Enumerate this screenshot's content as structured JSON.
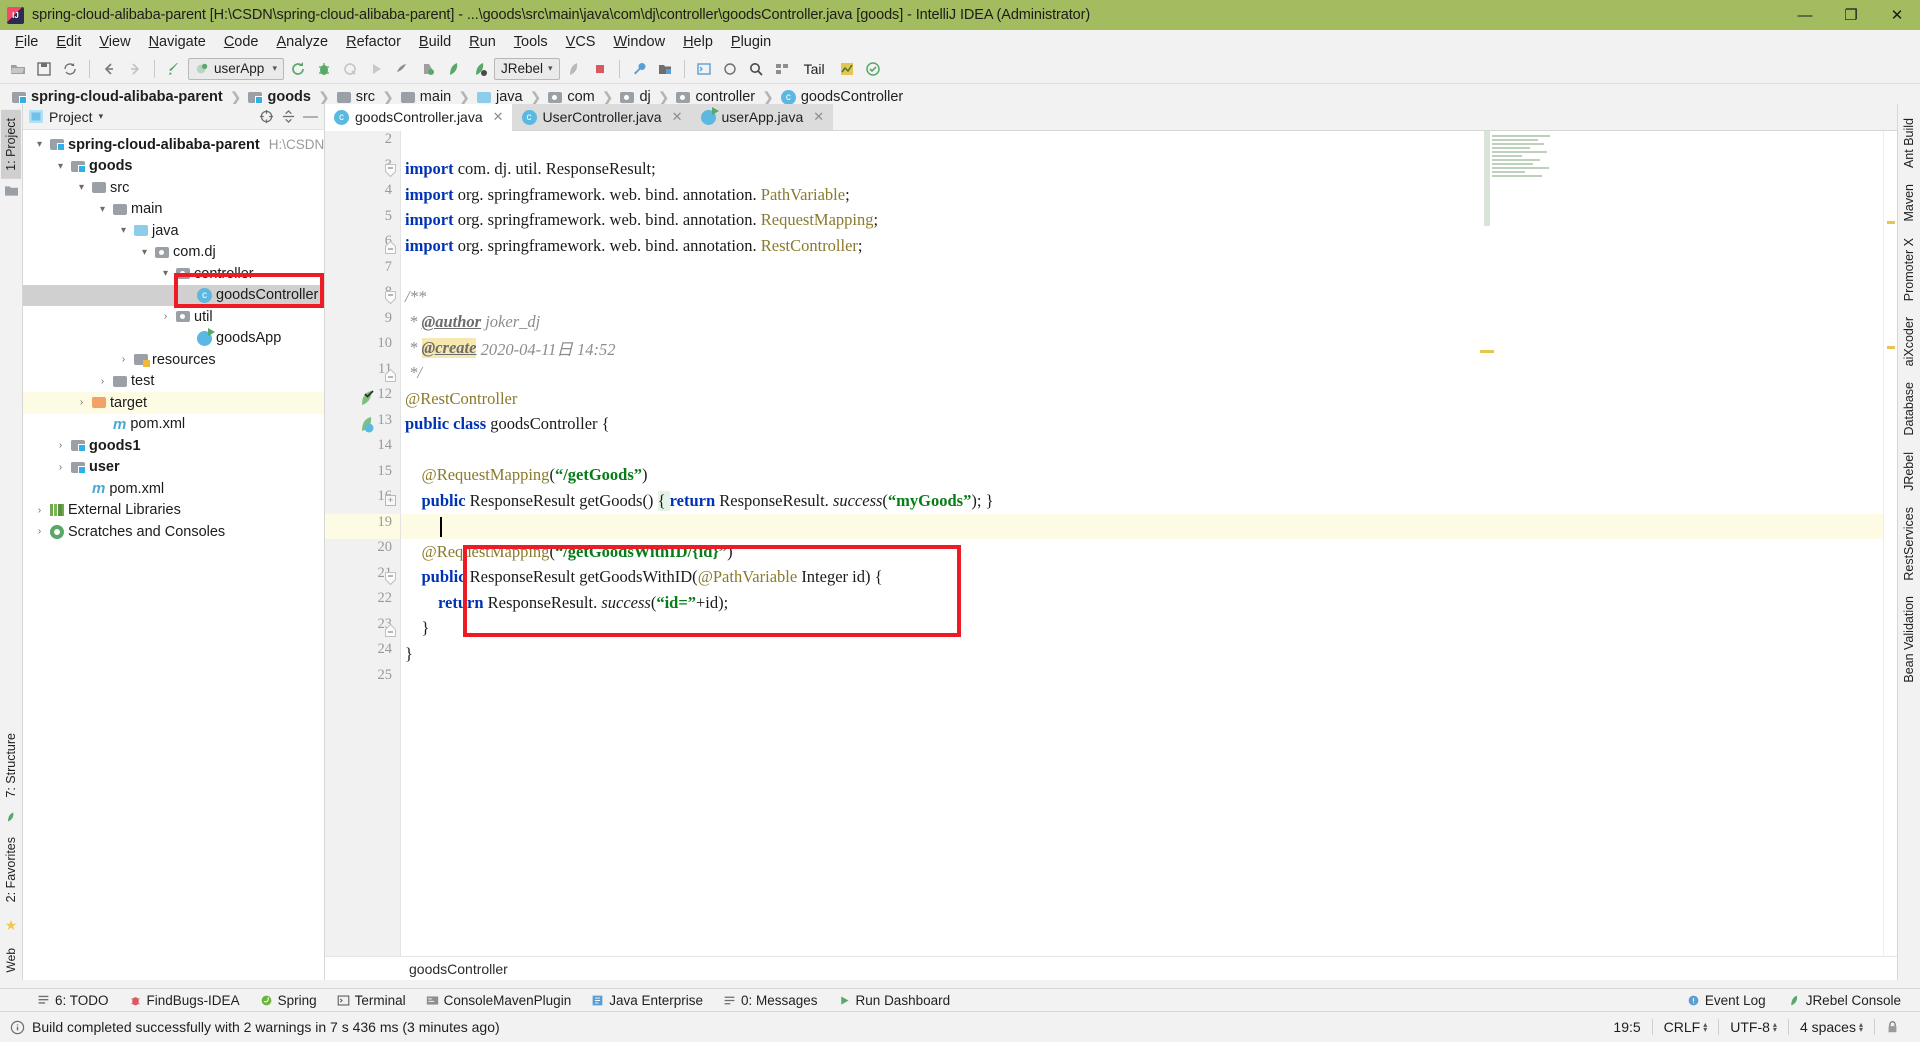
{
  "window": {
    "title": "spring-cloud-alibaba-parent [H:\\CSDN\\spring-cloud-alibaba-parent] - ...\\goods\\src\\main\\java\\com\\dj\\controller\\goodsController.java [goods] - IntelliJ IDEA (Administrator)",
    "minimize": "—",
    "maximize": "❐",
    "close": "✕"
  },
  "menubar": {
    "items": [
      "File",
      "Edit",
      "View",
      "Navigate",
      "Code",
      "Analyze",
      "Refactor",
      "Build",
      "Run",
      "Tools",
      "VCS",
      "Window",
      "Help",
      "Plugin"
    ]
  },
  "toolbar": {
    "run_config": "userApp",
    "jrebel_config": "JRebel",
    "tail_label": "Tail",
    "icons": [
      "open-project-icon",
      "save-all-icon",
      "sync-icon",
      "back-icon",
      "forward-icon",
      "build-icon",
      "rerun-icon",
      "debug-icon",
      "coverage-icon",
      "run-icon",
      "profile-icon",
      "stop-icon",
      "jrebel-run-icon",
      "jrebel-debug-icon",
      "jrebel-stop-icon",
      "stop-red-icon",
      "settings-wrench-icon",
      "project-structure-icon",
      "terminal-icon",
      "search-everywhere-icon",
      "compare-icon",
      "tail-icon",
      "chart-icon",
      "check-icon"
    ]
  },
  "breadcrumb": {
    "items": [
      {
        "label": "spring-cloud-alibaba-parent",
        "icon": "module-folder-icon",
        "bold": true
      },
      {
        "label": "goods",
        "icon": "module-folder-icon",
        "bold": true
      },
      {
        "label": "src",
        "icon": "folder-icon",
        "bold": false
      },
      {
        "label": "main",
        "icon": "folder-icon",
        "bold": false
      },
      {
        "label": "java",
        "icon": "source-folder-icon",
        "bold": false
      },
      {
        "label": "com",
        "icon": "package-icon",
        "bold": false
      },
      {
        "label": "dj",
        "icon": "package-icon",
        "bold": false
      },
      {
        "label": "controller",
        "icon": "package-icon",
        "bold": false
      },
      {
        "label": "goodsController",
        "icon": "class-icon",
        "bold": false
      }
    ]
  },
  "left_rail": {
    "top": [
      "1: Project"
    ],
    "bottom": [
      "7: Structure",
      "2: Favorites"
    ]
  },
  "right_rail": {
    "items": [
      "Ant Build",
      "Maven",
      "Promoter X",
      "aiXcoder",
      "Database",
      "JRebel",
      "RestServices",
      "Bean Validation"
    ]
  },
  "project_panel": {
    "title": "Project",
    "caret": "▾",
    "actions": [
      "target-icon",
      "collapse-all-icon",
      "hide-icon"
    ],
    "tree": [
      {
        "depth": 0,
        "arrow": "▾",
        "icon": "module-folder-icon",
        "label": "spring-cloud-alibaba-parent",
        "bold": true,
        "hint": "H:\\CSDN\\spri",
        "state": "normal"
      },
      {
        "depth": 1,
        "arrow": "▾",
        "icon": "module-folder-icon",
        "label": "goods",
        "bold": true,
        "hint": "",
        "state": "normal"
      },
      {
        "depth": 2,
        "arrow": "▾",
        "icon": "folder-icon",
        "label": "src",
        "bold": false,
        "hint": "",
        "state": "normal"
      },
      {
        "depth": 3,
        "arrow": "▾",
        "icon": "folder-icon",
        "label": "main",
        "bold": false,
        "hint": "",
        "state": "normal"
      },
      {
        "depth": 4,
        "arrow": "▾",
        "icon": "source-folder-icon",
        "label": "java",
        "bold": false,
        "hint": "",
        "state": "normal"
      },
      {
        "depth": 5,
        "arrow": "▾",
        "icon": "package-icon",
        "label": "com.dj",
        "bold": false,
        "hint": "",
        "state": "normal"
      },
      {
        "depth": 6,
        "arrow": "▾",
        "icon": "package-icon",
        "label": "controller",
        "bold": false,
        "hint": "",
        "state": "normal"
      },
      {
        "depth": 7,
        "arrow": "",
        "icon": "class-icon",
        "label": "goodsController",
        "bold": false,
        "hint": "",
        "state": "selected"
      },
      {
        "depth": 6,
        "arrow": "›",
        "icon": "package-icon",
        "label": "util",
        "bold": false,
        "hint": "",
        "state": "normal"
      },
      {
        "depth": 7,
        "arrow": "",
        "icon": "run-class-icon",
        "label": "goodsApp",
        "bold": false,
        "hint": "",
        "state": "normal"
      },
      {
        "depth": 4,
        "arrow": "›",
        "icon": "resources-folder-icon",
        "label": "resources",
        "bold": false,
        "hint": "",
        "state": "normal"
      },
      {
        "depth": 3,
        "arrow": "›",
        "icon": "folder-icon",
        "label": "test",
        "bold": false,
        "hint": "",
        "state": "normal"
      },
      {
        "depth": 2,
        "arrow": "›",
        "icon": "target-folder-icon",
        "label": "target",
        "bold": false,
        "hint": "",
        "state": "yellow"
      },
      {
        "depth": 3,
        "arrow": "",
        "icon": "maven-icon",
        "label": "pom.xml",
        "bold": false,
        "hint": "",
        "state": "normal"
      },
      {
        "depth": 1,
        "arrow": "›",
        "icon": "module-folder-icon",
        "label": "goods1",
        "bold": true,
        "hint": "",
        "state": "normal"
      },
      {
        "depth": 1,
        "arrow": "›",
        "icon": "module-folder-icon",
        "label": "user",
        "bold": true,
        "hint": "",
        "state": "normal"
      },
      {
        "depth": 2,
        "arrow": "",
        "icon": "maven-icon",
        "label": "pom.xml",
        "bold": false,
        "hint": "",
        "state": "normal"
      },
      {
        "depth": 0,
        "arrow": "›",
        "icon": "library-icon",
        "label": "External Libraries",
        "bold": false,
        "hint": "",
        "state": "normal"
      },
      {
        "depth": 0,
        "arrow": "›",
        "icon": "scratch-icon",
        "label": "Scratches and Consoles",
        "bold": false,
        "hint": "",
        "state": "normal"
      }
    ]
  },
  "editor": {
    "tabs": [
      {
        "label": "goodsController.java",
        "icon": "class-icon",
        "active": true,
        "close": "✕"
      },
      {
        "label": "UserController.java",
        "icon": "class-icon",
        "active": false,
        "close": "✕"
      },
      {
        "label": "userApp.java",
        "icon": "run-class-icon",
        "active": false,
        "close": "✕"
      }
    ],
    "footer_breadcrumb": "goodsController",
    "lines": [
      {
        "num": "2",
        "tokens": [],
        "fold": "",
        "mark": "",
        "cur": false
      },
      {
        "num": "3",
        "tokens": [
          {
            "t": "import ",
            "c": "kw"
          },
          {
            "t": "com. dj. util. ResponseResult;",
            "c": "type"
          }
        ],
        "fold": "top",
        "mark": "",
        "cur": false
      },
      {
        "num": "4",
        "tokens": [
          {
            "t": "import ",
            "c": "kw"
          },
          {
            "t": "org. springframework. web. bind. annotation. ",
            "c": "type"
          },
          {
            "t": "PathVariable",
            "c": "ann"
          },
          {
            "t": ";",
            "c": "type"
          }
        ],
        "fold": "",
        "mark": "",
        "cur": false
      },
      {
        "num": "5",
        "tokens": [
          {
            "t": "import ",
            "c": "kw"
          },
          {
            "t": "org. springframework. web. bind. annotation. ",
            "c": "type"
          },
          {
            "t": "RequestMapping",
            "c": "ann"
          },
          {
            "t": ";",
            "c": "type"
          }
        ],
        "fold": "",
        "mark": "",
        "cur": false
      },
      {
        "num": "6",
        "tokens": [
          {
            "t": "import ",
            "c": "kw"
          },
          {
            "t": "org. springframework. web. bind. annotation. ",
            "c": "type"
          },
          {
            "t": "RestController",
            "c": "ann"
          },
          {
            "t": ";",
            "c": "type"
          }
        ],
        "fold": "bottom",
        "mark": "",
        "cur": false
      },
      {
        "num": "7",
        "tokens": [],
        "fold": "",
        "mark": "",
        "cur": false
      },
      {
        "num": "8",
        "tokens": [
          {
            "t": "/**",
            "c": "cmt"
          }
        ],
        "fold": "top",
        "mark": "",
        "cur": false
      },
      {
        "num": "9",
        "tokens": [
          {
            "t": " * ",
            "c": "cmt"
          },
          {
            "t": "@author",
            "c": "cmt-tag"
          },
          {
            "t": " joker_dj",
            "c": "cmt"
          }
        ],
        "fold": "",
        "mark": "",
        "cur": false
      },
      {
        "num": "10",
        "tokens": [
          {
            "t": " * ",
            "c": "cmt"
          },
          {
            "t": "@create",
            "c": "cmt-tag hl-yellow"
          },
          {
            "t": " 2020-04-11日 14:52",
            "c": "cmt"
          }
        ],
        "fold": "",
        "mark": "",
        "cur": false
      },
      {
        "num": "11",
        "tokens": [
          {
            "t": " */",
            "c": "cmt"
          }
        ],
        "fold": "bottom",
        "mark": "",
        "cur": false
      },
      {
        "num": "12",
        "tokens": [
          {
            "t": "@RestController",
            "c": "ann"
          }
        ],
        "fold": "",
        "mark": "run-check-icon",
        "cur": false
      },
      {
        "num": "13",
        "tokens": [
          {
            "t": "public class ",
            "c": "kw"
          },
          {
            "t": "goodsController {",
            "c": "type"
          }
        ],
        "fold": "",
        "mark": "run-class-icon",
        "cur": false
      },
      {
        "num": "14",
        "tokens": [],
        "fold": "",
        "mark": "",
        "cur": false
      },
      {
        "num": "15",
        "tokens": [
          {
            "t": "    @RequestMapping",
            "c": "ann"
          },
          {
            "t": "(",
            "c": "type"
          },
          {
            "t": "“/getGoods”",
            "c": "str"
          },
          {
            "t": ")",
            "c": "type"
          }
        ],
        "fold": "",
        "mark": "",
        "cur": false
      },
      {
        "num": "16",
        "tokens": [
          {
            "t": "    ",
            "c": "type"
          },
          {
            "t": "public ",
            "c": "kw"
          },
          {
            "t": "ResponseResult getGoods() ",
            "c": "type"
          },
          {
            "t": "{ ",
            "c": "brace-hl"
          },
          {
            "t": "return ",
            "c": "kw"
          },
          {
            "t": "ResponseResult. ",
            "c": "type"
          },
          {
            "t": "success",
            "c": "meth"
          },
          {
            "t": "(",
            "c": "type"
          },
          {
            "t": "“myGoods”",
            "c": "str"
          },
          {
            "t": "); }",
            "c": "type"
          }
        ],
        "fold": "plus",
        "mark": "",
        "cur": false
      },
      {
        "num": "19",
        "tokens": [],
        "fold": "",
        "mark": "",
        "cur": true
      },
      {
        "num": "20",
        "tokens": [
          {
            "t": "    @RequestMapping",
            "c": "ann"
          },
          {
            "t": "(",
            "c": "type"
          },
          {
            "t": "“/getGoodsWithID/{id}”",
            "c": "str"
          },
          {
            "t": ")",
            "c": "type"
          }
        ],
        "fold": "",
        "mark": "",
        "cur": false
      },
      {
        "num": "21",
        "tokens": [
          {
            "t": "    ",
            "c": "type"
          },
          {
            "t": "public ",
            "c": "kw"
          },
          {
            "t": "ResponseResult getGoodsWithID(",
            "c": "type"
          },
          {
            "t": "@PathVariable",
            "c": "ann"
          },
          {
            "t": " Integer id) {",
            "c": "type"
          }
        ],
        "fold": "minus",
        "mark": "",
        "cur": false
      },
      {
        "num": "22",
        "tokens": [
          {
            "t": "        ",
            "c": "type"
          },
          {
            "t": "return ",
            "c": "kw"
          },
          {
            "t": "ResponseResult. ",
            "c": "type"
          },
          {
            "t": "success",
            "c": "meth"
          },
          {
            "t": "(",
            "c": "type"
          },
          {
            "t": "“id=”",
            "c": "str"
          },
          {
            "t": "+id);",
            "c": "type"
          }
        ],
        "fold": "",
        "mark": "",
        "cur": false
      },
      {
        "num": "23",
        "tokens": [
          {
            "t": "    }",
            "c": "type"
          }
        ],
        "fold": "bottom2",
        "mark": "",
        "cur": false
      },
      {
        "num": "24",
        "tokens": [
          {
            "t": "}",
            "c": "type"
          }
        ],
        "fold": "",
        "mark": "",
        "cur": false
      },
      {
        "num": "25",
        "tokens": [],
        "fold": "",
        "mark": "",
        "cur": false
      }
    ]
  },
  "bottom_bar": {
    "items": [
      {
        "label": "6: TODO",
        "icon": "todo-icon"
      },
      {
        "label": "FindBugs-IDEA",
        "icon": "findbugs-icon"
      },
      {
        "label": "Spring",
        "icon": "spring-icon"
      },
      {
        "label": "Terminal",
        "icon": "terminal-icon"
      },
      {
        "label": "ConsoleMavenPlugin",
        "icon": "maven-console-icon"
      },
      {
        "label": "Java Enterprise",
        "icon": "java-enterprise-icon"
      },
      {
        "label": "0: Messages",
        "icon": "messages-icon"
      },
      {
        "label": "Run Dashboard",
        "icon": "run-dashboard-icon"
      }
    ],
    "right_items": [
      {
        "label": "Event Log",
        "icon": "event-log-icon"
      },
      {
        "label": "JRebel Console",
        "icon": "jrebel-icon"
      }
    ]
  },
  "statusbar": {
    "message": "Build completed successfully with 2 warnings in 7 s 436 ms (3 minutes ago)",
    "message_icon": "info-icon",
    "caret_position": "19:5",
    "line_separator": "CRLF",
    "encoding": "UTF-8",
    "indent": "4 spaces",
    "lock_icon": "lock-icon"
  },
  "colors": {
    "title_bg": "#a2bc5f",
    "chrome_bg": "#f2f2f2",
    "editor_bg": "#ffffff",
    "selection": "#d0d0d0",
    "highlight_row": "#fdfbe4",
    "annotation_box": "#ee1b24",
    "keyword": "#0033b3",
    "string": "#067d17",
    "annotation": "#8a7a2c",
    "comment": "#8c8c8c"
  }
}
